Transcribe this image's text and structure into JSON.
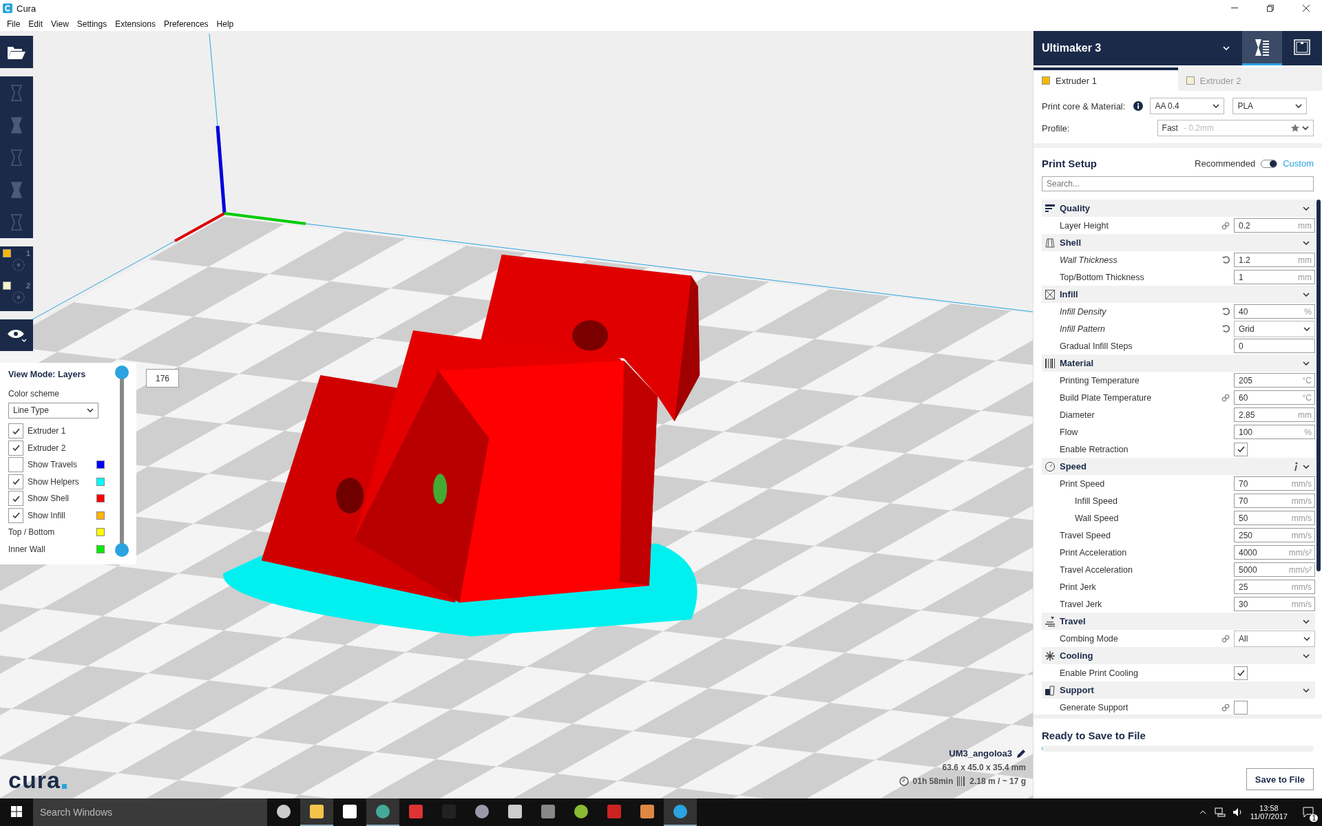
{
  "window": {
    "title": "Cura"
  },
  "menu": [
    "File",
    "Edit",
    "View",
    "Settings",
    "Extensions",
    "Preferences",
    "Help"
  ],
  "left_toolbar": {
    "extruders": [
      {
        "label": "1",
        "color": "#f5b800"
      },
      {
        "label": "2",
        "color": "#f5f0d0"
      }
    ]
  },
  "layer_view": {
    "title": "View Mode: Layers",
    "color_scheme_label": "Color scheme",
    "color_scheme": "Line Type",
    "items": [
      {
        "kind": "check",
        "label": "Extruder 1",
        "checked": true
      },
      {
        "kind": "check",
        "label": "Extruder 2",
        "checked": true
      },
      {
        "kind": "check",
        "label": "Show Travels",
        "checked": false,
        "color": "#0000ff"
      },
      {
        "kind": "check",
        "label": "Show Helpers",
        "checked": true,
        "color": "#00ffff"
      },
      {
        "kind": "check",
        "label": "Show Shell",
        "checked": true,
        "color": "#ff0000"
      },
      {
        "kind": "check",
        "label": "Show Infill",
        "checked": true,
        "color": "#ffb300"
      },
      {
        "kind": "legend",
        "label": "Top / Bottom",
        "color": "#ffff00"
      },
      {
        "kind": "legend",
        "label": "Inner Wall",
        "color": "#00ee00"
      }
    ],
    "slider": {
      "value": "176",
      "handles": [
        {
          "level": 1
        },
        {
          "level": 0
        }
      ]
    }
  },
  "logo": "cura",
  "job": {
    "name": "UM3_angoloa3",
    "dimensions": "63.6 x 45.0 x 35.4 mm",
    "time": "01h 58min",
    "material": "2.18 m / ~ 17 g"
  },
  "printer_panel": {
    "printer": "Ultimaker 3",
    "extruder_tabs": [
      {
        "label": "Extruder 1",
        "selected": true,
        "color": "#f5b800"
      },
      {
        "label": "Extruder 2",
        "selected": false,
        "color": "#f5f0d0"
      }
    ],
    "core_label": "Print core & Material:",
    "core": "AA 0.4",
    "material": "PLA",
    "profile_label": "Profile:",
    "profile": "Fast",
    "profile_detail": "- 0.2mm"
  },
  "print_setup": {
    "title": "Print Setup",
    "recommended": "Recommended",
    "custom": "Custom",
    "custom_on": true,
    "search_placeholder": "Search...",
    "categories": [
      {
        "label": "Quality",
        "info": false,
        "rows": [
          {
            "label": "Layer Height",
            "kind": "number",
            "value": "0.2",
            "unit": "mm",
            "modified": false,
            "linked": true
          }
        ]
      },
      {
        "label": "Shell",
        "info": false,
        "rows": [
          {
            "label": "Wall Thickness",
            "kind": "number",
            "value": "1.2",
            "unit": "mm",
            "modified": true,
            "linked": false
          },
          {
            "label": "Top/Bottom Thickness",
            "kind": "number",
            "value": "1",
            "unit": "mm",
            "modified": false,
            "linked": false
          }
        ]
      },
      {
        "label": "Infill",
        "info": false,
        "rows": [
          {
            "label": "Infill Density",
            "kind": "number",
            "value": "40",
            "unit": "%",
            "modified": true,
            "linked": false
          },
          {
            "label": "Infill Pattern",
            "kind": "select",
            "value": "Grid",
            "modified": true,
            "linked": false
          },
          {
            "label": "Gradual Infill Steps",
            "kind": "number",
            "value": "0",
            "modified": false,
            "linked": false
          }
        ]
      },
      {
        "label": "Material",
        "info": false,
        "rows": [
          {
            "label": "Printing Temperature",
            "kind": "number",
            "value": "205",
            "unit": "°C",
            "modified": false,
            "linked": false
          },
          {
            "label": "Build Plate Temperature",
            "kind": "number",
            "value": "60",
            "unit": "°C",
            "modified": false,
            "linked": true
          },
          {
            "label": "Diameter",
            "kind": "number",
            "value": "2.85",
            "unit": "mm",
            "modified": false,
            "linked": false
          },
          {
            "label": "Flow",
            "kind": "number",
            "value": "100",
            "unit": "%",
            "modified": false,
            "linked": false
          },
          {
            "label": "Enable Retraction",
            "kind": "checkbox",
            "checked": true,
            "modified": false,
            "linked": false
          }
        ]
      },
      {
        "label": "Speed",
        "info": true,
        "rows": [
          {
            "label": "Print Speed",
            "kind": "number",
            "value": "70",
            "unit": "mm/s",
            "modified": false,
            "linked": false,
            "children": [
              {
                "label": "Infill Speed",
                "kind": "number",
                "value": "70",
                "unit": "mm/s",
                "modified": false,
                "linked": false
              },
              {
                "label": "Wall Speed",
                "kind": "number",
                "value": "50",
                "unit": "mm/s",
                "modified": false,
                "linked": false
              }
            ]
          },
          {
            "label": "Travel Speed",
            "kind": "number",
            "value": "250",
            "unit": "mm/s",
            "modified": false,
            "linked": false
          },
          {
            "label": "Print Acceleration",
            "kind": "number",
            "value": "4000",
            "unit": "mm/s²",
            "modified": false,
            "linked": false
          },
          {
            "label": "Travel Acceleration",
            "kind": "number",
            "value": "5000",
            "unit": "mm/s²",
            "modified": false,
            "linked": false
          },
          {
            "label": "Print Jerk",
            "kind": "number",
            "value": "25",
            "unit": "mm/s",
            "modified": false,
            "linked": false
          },
          {
            "label": "Travel Jerk",
            "kind": "number",
            "value": "30",
            "unit": "mm/s",
            "modified": false,
            "linked": false
          }
        ]
      },
      {
        "label": "Travel",
        "info": false,
        "rows": [
          {
            "label": "Combing Mode",
            "kind": "select",
            "value": "All",
            "modified": false,
            "linked": true
          }
        ]
      },
      {
        "label": "Cooling",
        "info": false,
        "rows": [
          {
            "label": "Enable Print Cooling",
            "kind": "checkbox",
            "checked": true,
            "modified": false,
            "linked": false
          }
        ]
      },
      {
        "label": "Support",
        "info": false,
        "rows": [
          {
            "label": "Generate Support",
            "kind": "checkbox",
            "checked": false,
            "modified": false,
            "linked": true
          }
        ]
      }
    ]
  },
  "output": {
    "status": "Ready to Save to File",
    "level": 0,
    "button": "Save to File"
  },
  "taskbar": {
    "search_placeholder": "Search Windows",
    "time": "13:58",
    "date": "11/07/2017",
    "notifications": "1"
  }
}
